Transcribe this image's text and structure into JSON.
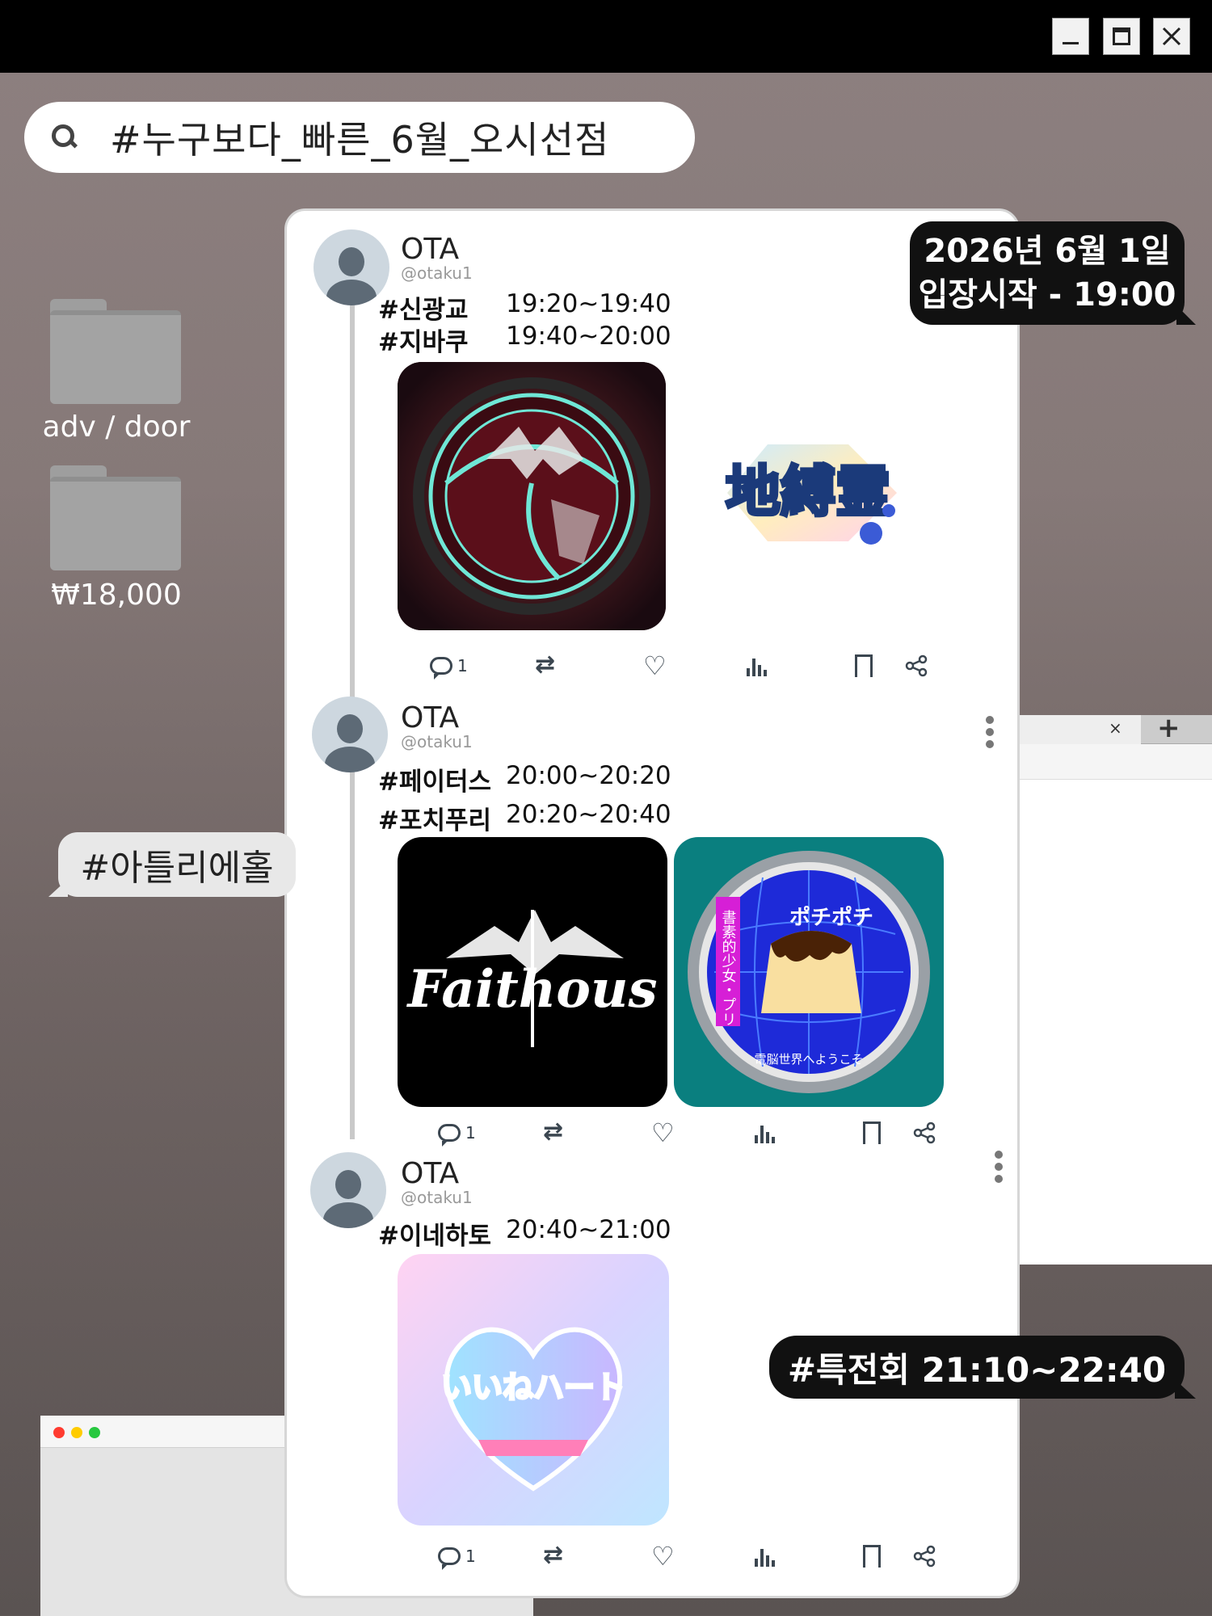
{
  "search": {
    "query": "#누구보다_빠른_6월_오시선점",
    "icon": "search-icon"
  },
  "desktop": {
    "folders": [
      {
        "label": "adv / door"
      },
      {
        "label": "₩18,000"
      }
    ]
  },
  "bubbles": {
    "date_line1": "2026년 6월 1일",
    "date_line2": "입장시작 - 19:00",
    "hall": "#아틀리에홀",
    "special": "#특전회 21:10~22:40"
  },
  "posts": [
    {
      "user": "OTA",
      "handle": "@otaku1",
      "lines": [
        {
          "tag": "#신광교",
          "time": "19:20~19:40"
        },
        {
          "tag": "#지바쿠",
          "time": "19:40~20:00"
        }
      ],
      "images": [
        "circular-crest-logo",
        "地縛霊"
      ],
      "reply_count": "1"
    },
    {
      "user": "OTA",
      "handle": "@otaku1",
      "lines": [
        {
          "tag": "#페이터스",
          "time": "20:00~20:20"
        },
        {
          "tag": "#포치푸리",
          "time": "20:20~20:40"
        }
      ],
      "images": [
        "Faithous",
        "ポチポチ"
      ],
      "image_texts": {
        "pochi_sub": "電脳世界へようこそ",
        "pochi_side": "書素的少女・プリ"
      },
      "reply_count": "1"
    },
    {
      "user": "OTA",
      "handle": "@otaku1",
      "lines": [
        {
          "tag": "#이네하토",
          "time": "20:40~21:00"
        }
      ],
      "images": [
        "いいねハート"
      ],
      "reply_count": "1"
    }
  ],
  "colors": {
    "titlebar": "#000000",
    "bubble_dark": "#111111",
    "bubble_light": "#e8e8e8",
    "card": "#ffffff"
  }
}
